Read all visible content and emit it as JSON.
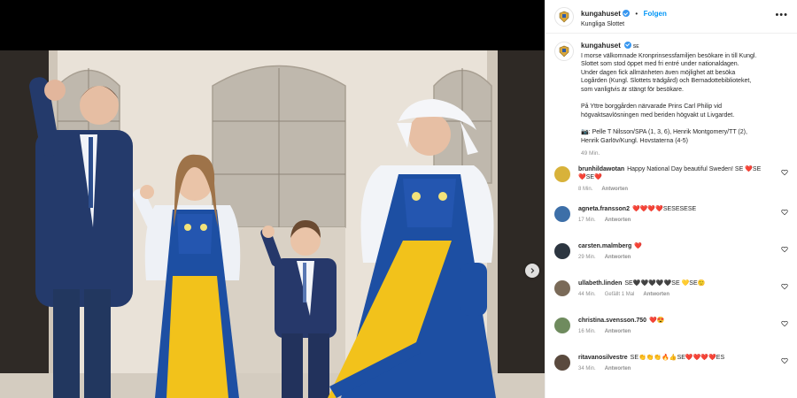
{
  "post": {
    "account": "kungahuset",
    "follow_label": "Folgen",
    "location": "Kungliga Slottet",
    "more_label": "•••"
  },
  "caption": {
    "username": "kungahuset",
    "flag": "SE",
    "lines": [
      "I morse välkomnade Kronprinsessfamiljen besökare in till Kungl.",
      "Slottet som stod öppet med fri entré under nationaldagen.",
      "Under dagen fick allmänheten även möjlighet att besöka",
      "Logården (Kungl. Slottets trädgård) och Bernadottebiblioteket,",
      "som vanligtvis är stängt för besökare."
    ],
    "para2": [
      "På Yttre borggården närvarade Prins Carl Philip vid",
      "högvaktsavlösningen med beriden högvakt ut Livgardet."
    ],
    "para3": [
      "📷: Pelle T Nilsson/SPA (1, 3, 6), Henrik Montgomery/TT (2),",
      "Henrik Garlöv/Kungl. Hovstaterna (4-5)"
    ],
    "time": "49 Min."
  },
  "comments": [
    {
      "user": "brunhildawotan",
      "text": "Happy National Day beautiful Sweden! SE ❤️SE",
      "text2": "❤️SE❤️",
      "time": "8 Min.",
      "likes": "",
      "reply": "Antworten",
      "avatar_color": "#d8b23a"
    },
    {
      "user": "agneta.fransson2",
      "text": "❤️❤️❤️❤️SESESESE",
      "text2": "",
      "time": "17 Min.",
      "likes": "",
      "reply": "Antworten",
      "avatar_color": "#3d6fa8"
    },
    {
      "user": "carsten.malmberg",
      "text": "❤️",
      "text2": "",
      "time": "29 Min.",
      "likes": "",
      "reply": "Antworten",
      "avatar_color": "#2c3540"
    },
    {
      "user": "ullabeth.linden",
      "text": "SE🖤🖤🖤🖤🖤SE 💛SE🙂",
      "text2": "",
      "time": "44 Min.",
      "likes": "Gefällt 1 Mal",
      "reply": "Antworten",
      "avatar_color": "#7a6a58"
    },
    {
      "user": "christina.svensson.750",
      "text": "❤️😍",
      "text2": "",
      "time": "16 Min.",
      "likes": "",
      "reply": "Antworten",
      "avatar_color": "#6f8b5e"
    },
    {
      "user": "ritavanosilvestre",
      "text": "SE👏👏👏🔥👍SE❤️❤️❤️❤️ES",
      "text2": "",
      "time": "34 Min.",
      "likes": "",
      "reply": "Antworten",
      "avatar_color": "#5a4a3e"
    }
  ],
  "colors": {
    "follow": "#0095f6",
    "verified": "#3897f0",
    "heart": "#ed4956",
    "dress_blue": "#1d4fa3",
    "apron_yellow": "#f2c21b",
    "suit_navy": "#243a6b"
  },
  "icons": {
    "next": "chevron-right-icon",
    "more": "more-options-icon",
    "like": "heart-outline-icon",
    "verified": "verified-badge-icon"
  }
}
